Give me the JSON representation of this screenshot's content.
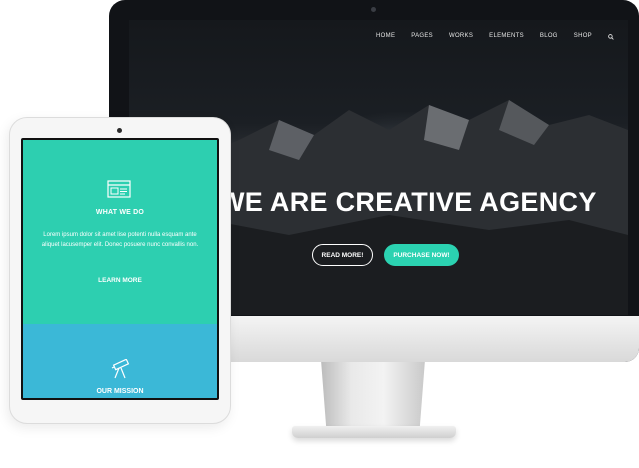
{
  "website": {
    "nav": {
      "items": [
        "HOME",
        "PAGES",
        "WORKS",
        "ELEMENTS",
        "BLOG",
        "SHOP"
      ],
      "search_icon": "search-icon"
    },
    "hero": {
      "title": "WE ARE CREATIVE AGENCY",
      "read_more": "READ MORE!",
      "purchase": "PURCHASE NOW!"
    }
  },
  "tablet": {
    "what_we_do": {
      "icon": "browser-window-icon",
      "title": "WHAT WE DO",
      "body": "Lorem ipsum dolor sit amet lise potenti nulla esquam ante aliquet lacusemper elit. Donec posuere nunc convallis non.",
      "link": "LEARN MORE"
    },
    "our_mission": {
      "icon": "telescope-icon",
      "title": "OUR MISSION"
    }
  },
  "colors": {
    "teal": "#2dcfb0",
    "blue": "#3bb8d7",
    "dark": "#111317"
  }
}
